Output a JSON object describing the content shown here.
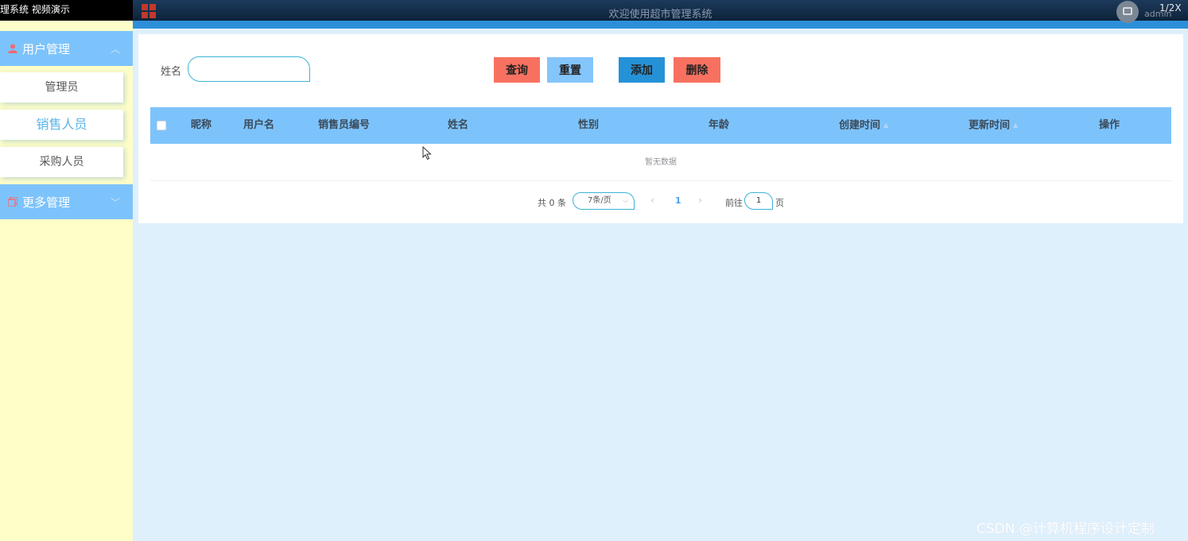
{
  "overlay": {
    "title": "理系统 视频演示",
    "page_ratio": "1/2X"
  },
  "header": {
    "title": "欢迎使用超市管理系统",
    "user": "admin"
  },
  "sidebar": {
    "groups": [
      {
        "label": "用户管理",
        "expanded": true
      },
      {
        "label": "更多管理",
        "expanded": false
      }
    ],
    "items": [
      {
        "label": "管理员"
      },
      {
        "label": "销售人员",
        "active": true
      },
      {
        "label": "采购人员"
      }
    ]
  },
  "search": {
    "label": "姓名",
    "value": "",
    "placeholder": ""
  },
  "buttons": {
    "query": "查询",
    "reset": "重置",
    "add": "添加",
    "delete": "删除"
  },
  "table": {
    "columns": [
      "昵称",
      "用户名",
      "销售员编号",
      "姓名",
      "性别",
      "年龄",
      "创建时间",
      "更新时间",
      "操作"
    ],
    "empty_text": "暂无数据"
  },
  "pagination": {
    "total_text": "共 0 条",
    "page_size": "7条/页",
    "current_page": "1",
    "goto_label": "前往",
    "goto_value": "1",
    "page_unit": "页"
  },
  "watermark": "CSDN @计算机程序设计定制",
  "colors": {
    "sidebar_bg": "#fefec8",
    "menu_group_bg": "#7dc3fb",
    "main_bg": "#dff0fd",
    "danger": "#f87160",
    "primary": "#2592d8",
    "accent": "#84c5fb"
  }
}
